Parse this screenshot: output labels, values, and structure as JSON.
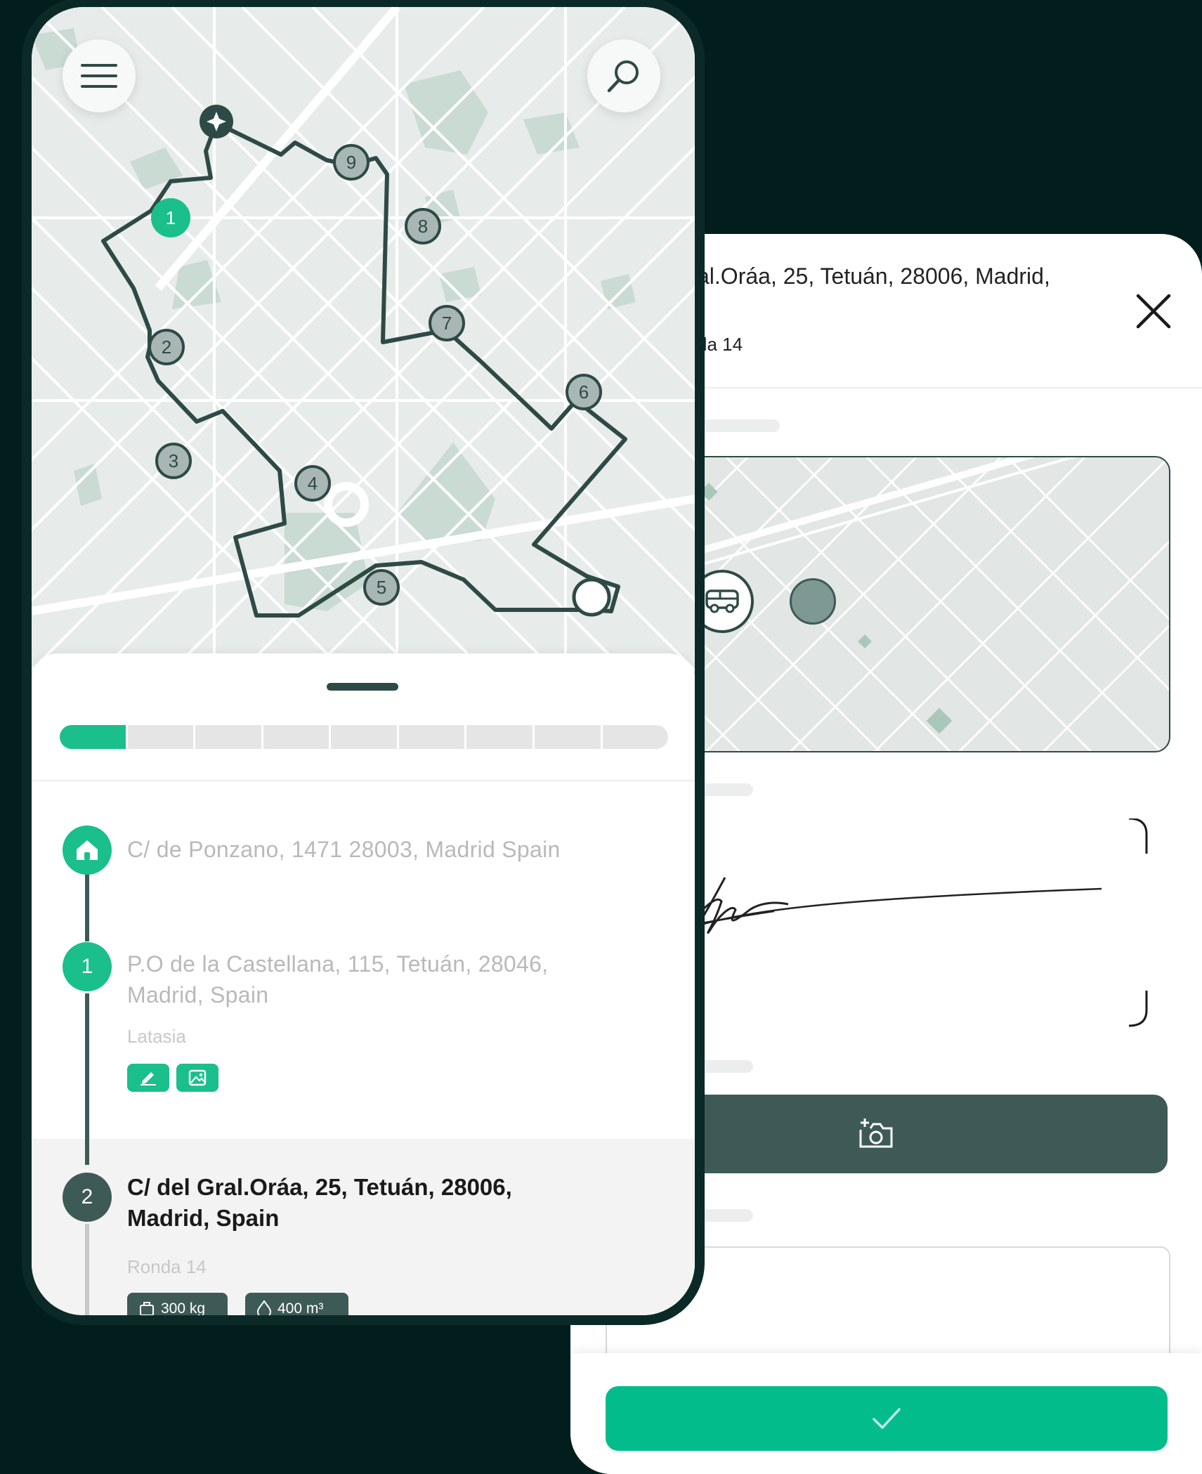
{
  "colors": {
    "background": "#021e1c",
    "accent_green": "#1abf8c",
    "dark_teal": "#3e5a57",
    "map_route": "#2e4a47"
  },
  "route_map": {
    "menu_icon": "hamburger-menu-icon",
    "search_icon": "search-icon",
    "depot_icon": "sparkle-icon",
    "stop_markers": [
      "1",
      "2",
      "3",
      "4",
      "5",
      "6",
      "7",
      "8",
      "9"
    ],
    "active_stop": "1"
  },
  "progress": {
    "completed_segments": 1,
    "total_segments": 9
  },
  "stops": [
    {
      "marker_icon": "home-icon",
      "address": "C/ de Ponzano, 1471 28003, Madrid Spain"
    },
    {
      "number": "1",
      "address_line1": "P.O de la Castellana, 115, Tetuán, 28046,",
      "address_line2": "Madrid, Spain",
      "note": "Latasia",
      "badges": [
        "signature-icon",
        "image-icon"
      ]
    },
    {
      "number": "2",
      "address_line1": "C/ del Gral.Oráa, 25, Tetuán, 28006,",
      "address_line2": "Madrid, Spain",
      "note": "Ronda 14",
      "weight": "300 kg",
      "volume": "400 m³"
    }
  ],
  "detail": {
    "address": "al.Oráa, 25, Tetuán, 28006, Madrid,",
    "subtitle": "da 14",
    "close_icon": "close-icon",
    "vehicle_icon": "van-icon",
    "camera_icon": "camera-add-icon",
    "confirm_icon": "checkmark-icon"
  }
}
